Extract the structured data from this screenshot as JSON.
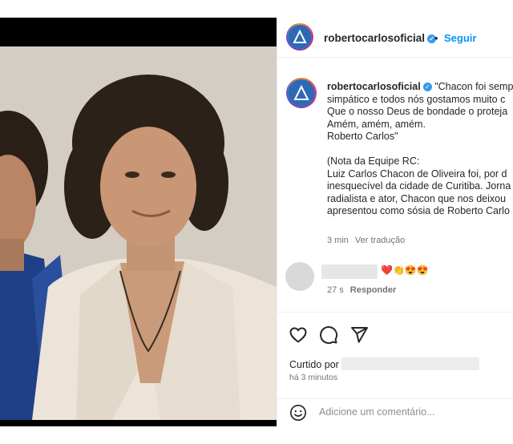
{
  "post": {
    "username": "robertocarlosoficial",
    "follow_label": "Seguir",
    "separator": "•"
  },
  "caption": {
    "username": "robertocarlosoficial",
    "lines": [
      "\"Chacon foi semp",
      "simpático e todos nós gostamos muito c",
      "Que o nosso Deus de bondade o proteja",
      "Amém, amém, amém.",
      "Roberto Carlos\"",
      "",
      "(Nota da Equipe RC:",
      "Luiz Carlos Chacon de Oliveira foi, por d",
      "inesquecível da cidade de Curitiba. Jorna",
      "radialista e ator, Chacon que nos deixou",
      "apresentou como sósia de Roberto Carlo"
    ],
    "time": "3 min",
    "translate": "Ver tradução"
  },
  "comment": {
    "emojis": "❤️👏😍😍",
    "time": "27 s",
    "reply": "Responder"
  },
  "actions": {
    "like_icon": "heart-icon",
    "comment_icon": "comment-icon",
    "share_icon": "share-icon"
  },
  "likes": {
    "prefix": "Curtido por",
    "ago": "há 3 minutos"
  },
  "add_comment": {
    "placeholder": "Adicione um comentário...",
    "emoji_icon": "smiley-icon"
  },
  "colors": {
    "link_blue": "#0095f6",
    "verified_blue": "#3897f0",
    "text": "#262626",
    "muted": "#737373"
  }
}
